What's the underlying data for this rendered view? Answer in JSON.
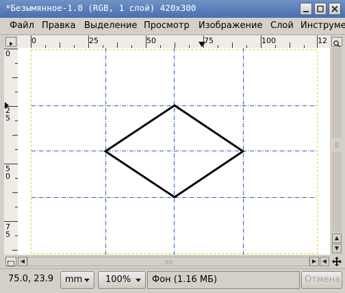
{
  "window": {
    "title": "*Безымянное-1.0 (RGB, 1 слой) 420x300"
  },
  "menu": [
    {
      "label": "Файл"
    },
    {
      "label": "Правка"
    },
    {
      "label": "Выделение"
    },
    {
      "label": "Просмотр"
    },
    {
      "label": "Изображение"
    },
    {
      "label": "Слой"
    },
    {
      "label": "Инструме"
    }
  ],
  "ruler": {
    "horizontal_labels": [
      "0",
      "25",
      "50",
      "75",
      "100",
      "12"
    ],
    "vertical_labels": [
      "0",
      "2\n5",
      "5\n0",
      "7\n5"
    ]
  },
  "status": {
    "coords": "75.0, 23.9",
    "unit": "mm",
    "zoom": "100%",
    "layer_info": "Фон (1.16 МБ)",
    "cancel_label": "Отмена"
  },
  "colors": {
    "titlebar": "#4a6fae",
    "guide": "#2a5fb0",
    "canvas_border": "#e8d000",
    "shape_stroke": "#000000"
  }
}
